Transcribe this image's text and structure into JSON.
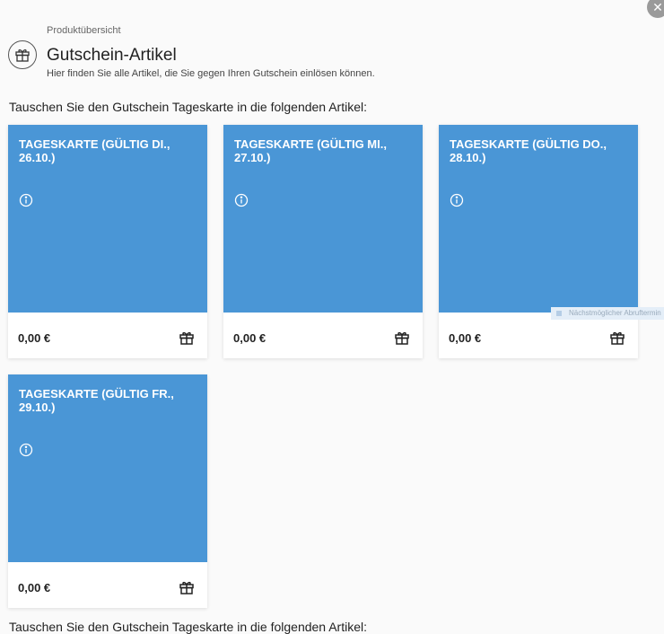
{
  "close_symbol": "✕",
  "breadcrumb": "Produktübersicht",
  "header": {
    "icon": "gift-icon",
    "title": "Gutschein-Artikel",
    "subtitle": "Hier finden Sie alle Artikel, die Sie gegen Ihren Gutschein einlösen können."
  },
  "intro": "Tauschen Sie den Gutschein Tageskarte in die folgenden Artikel:",
  "cards": [
    {
      "title": "TAGESKARTE (GÜLTIG DI., 26.10.)",
      "price": "0,00 €"
    },
    {
      "title": "TAGESKARTE (GÜLTIG MI., 27.10.)",
      "price": "0,00 €"
    },
    {
      "title": "TAGESKARTE (GÜLTIG DO., 28.10.)",
      "price": "0,00 €"
    },
    {
      "title": "TAGESKARTE (GÜLTIG FR., 29.10.)",
      "price": "0,00 €"
    }
  ],
  "tooltip": "Nächstmöglicher Abruftermin",
  "footer_text": "Tauschen Sie den Gutschein Tageskarte in die folgenden Artikel:",
  "colors": {
    "card_blue": "#4a96d6",
    "background": "#fafafa"
  }
}
